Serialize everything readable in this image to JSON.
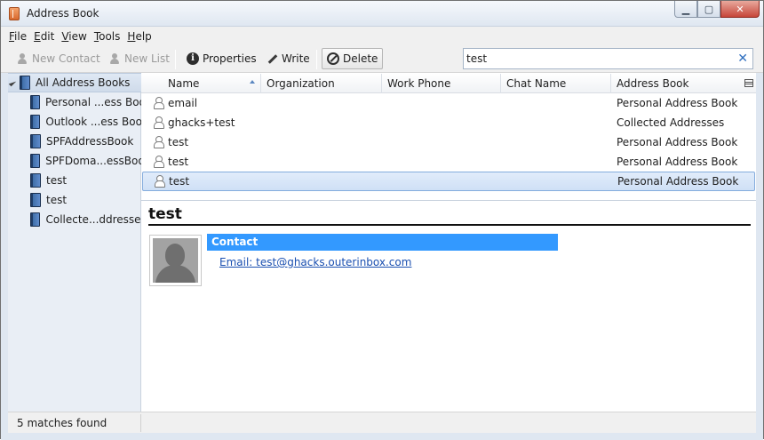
{
  "window": {
    "title": "Address Book"
  },
  "menu": [
    {
      "acc": "F",
      "rest": "ile"
    },
    {
      "acc": "E",
      "rest": "dit"
    },
    {
      "acc": "V",
      "rest": "iew"
    },
    {
      "acc": "T",
      "rest": "ools"
    },
    {
      "acc": "H",
      "rest": "elp"
    }
  ],
  "toolbar": {
    "new_contact": "New Contact",
    "new_list": "New List",
    "properties": "Properties",
    "write": "Write",
    "delete": "Delete"
  },
  "search": {
    "value": "test"
  },
  "sidebar": {
    "root": "All Address Books",
    "items": [
      "Personal ...ess Book",
      "Outlook ...ess Book",
      "SPFAddressBook",
      "SPFDoma...essBook",
      "test",
      "test",
      "Collecte...ddresses"
    ]
  },
  "columns": {
    "name": "Name",
    "organization": "Organization",
    "work_phone": "Work Phone",
    "chat_name": "Chat Name",
    "address_book": "Address Book"
  },
  "rows": [
    {
      "name": "email",
      "organization": "",
      "work_phone": "",
      "chat_name": "",
      "address_book": "Personal Address Book"
    },
    {
      "name": "ghacks+test",
      "organization": "",
      "work_phone": "",
      "chat_name": "",
      "address_book": "Collected Addresses"
    },
    {
      "name": "test",
      "organization": "",
      "work_phone": "",
      "chat_name": "",
      "address_book": "Personal Address Book"
    },
    {
      "name": "test",
      "organization": "",
      "work_phone": "",
      "chat_name": "",
      "address_book": "Personal Address Book"
    },
    {
      "name": "test",
      "organization": "",
      "work_phone": "",
      "chat_name": "",
      "address_book": "Personal Address Book"
    }
  ],
  "selected_row": 4,
  "detail": {
    "name": "test",
    "section": "Contact",
    "email": "Email: test@ghacks.outerinbox.com"
  },
  "status": {
    "text": "5 matches found"
  },
  "colors": {
    "accent": "#3399ff",
    "selection": "#cfe0f6",
    "link": "#1a4fb0",
    "close": "#c6463a"
  }
}
